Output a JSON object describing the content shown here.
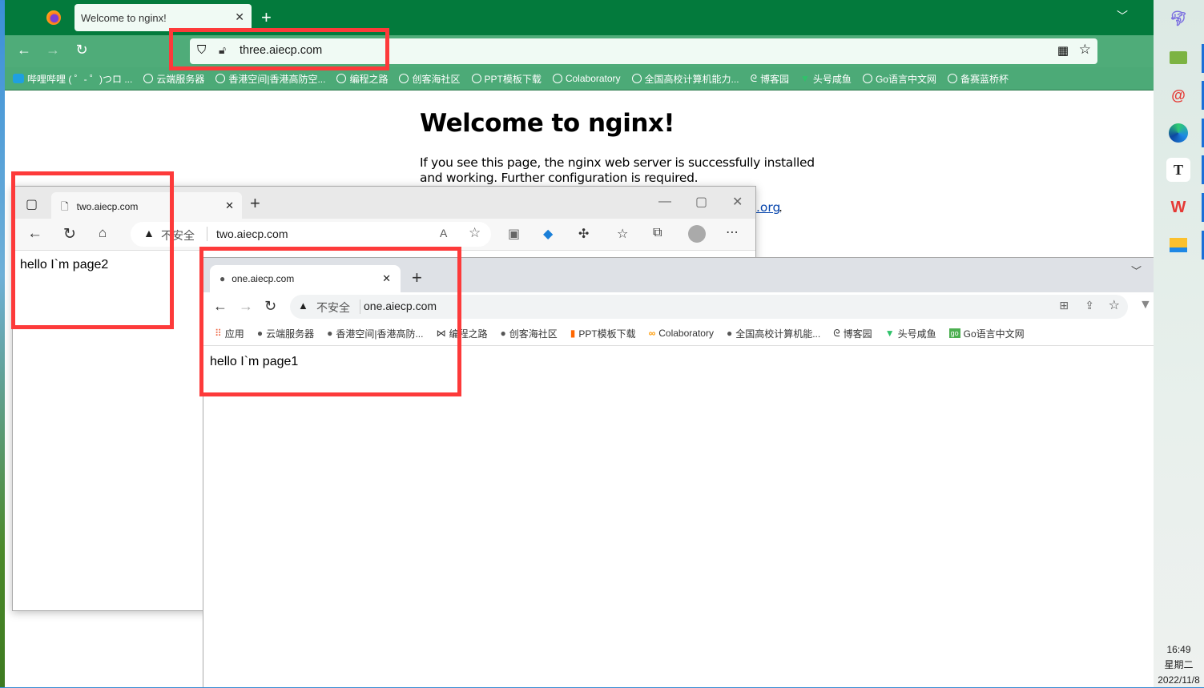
{
  "firefox": {
    "tab_title": "Welcome to nginx!",
    "url": "three.aiecp.com",
    "bookmarks": [
      "哔哩哔哩 ( ゜- ゜)つロ ...",
      "云端服务器",
      "香港空间|香港高防空...",
      "编程之路",
      "创客海社区",
      "PPT模板下载",
      "Colaboratory",
      "全国高校计算机能力...",
      "博客园",
      "头号咸鱼",
      "Go语言中文网",
      "备赛蓝桥杯"
    ],
    "theme_color": "#037a3c"
  },
  "nginx": {
    "heading": "Welcome to nginx!",
    "para1": "If you see this page, the nginx web server is successfully installed and working. Further configuration is required.",
    "link_fragment": ".org",
    "link_suffix": "."
  },
  "edge": {
    "tab_title": "two.aiecp.com",
    "security": "不安全",
    "url": "two.aiecp.com",
    "content": "hello I`m page2"
  },
  "chrome": {
    "tab_title": "one.aiecp.com",
    "security": "不安全",
    "url": "one.aiecp.com",
    "bookmarks": [
      "应用",
      "云端服务器",
      "香港空间|香港高防...",
      "编程之路",
      "创客海社区",
      "PPT模板下载",
      "Colaboratory",
      "全国高校计算机能...",
      "博客园",
      "头号咸鱼",
      "Go语言中文网"
    ],
    "content": "hello I`m page1"
  },
  "taskbar": {
    "apps": [
      "dolphin-icon",
      "folder-sync-icon",
      "snail-icon",
      "edge-icon",
      "typora-icon",
      "wps-icon",
      "file-explorer-icon"
    ],
    "time": "16:49",
    "weekday": "星期二",
    "date": "2022/11/8"
  },
  "highlight_color": "#fd3a3a"
}
